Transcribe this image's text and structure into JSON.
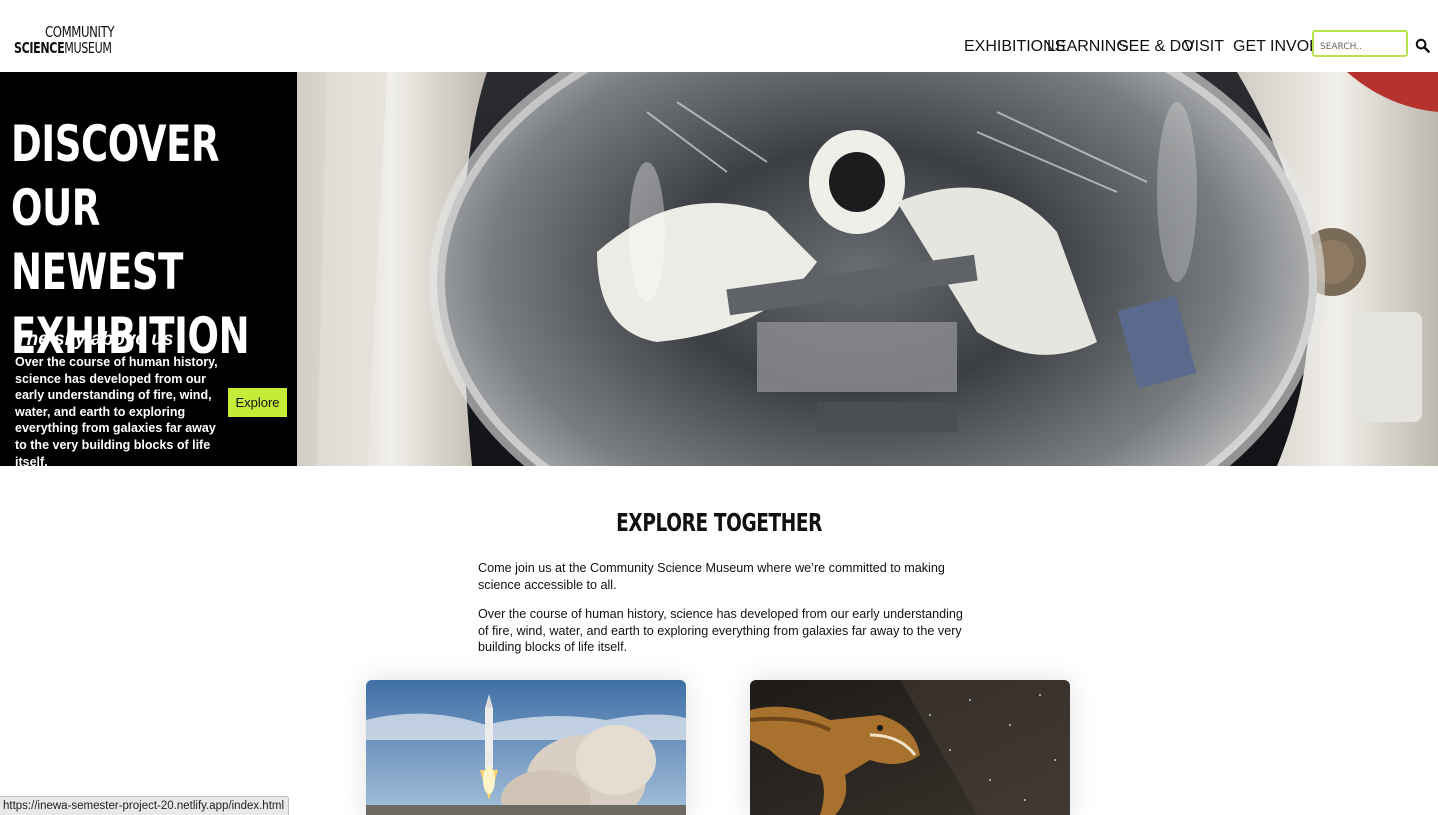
{
  "header": {
    "logo": {
      "line1": "COMMUNITY",
      "line2_bold": "SCIENCE",
      "line2_rest": "MUSEUM"
    },
    "nav": [
      "EXHIBITIONS",
      "LEARNING",
      "SEE & DO",
      "VISIT",
      "GET INVOLVED"
    ],
    "search": {
      "placeholder": "SEARCH.."
    },
    "accent_color": "#c6ec3a"
  },
  "hero": {
    "title": "DISCOVER OUR\nNEWEST\nEXHIBITION",
    "subtitle": "The sky above us",
    "description": "Over the course of human history, science has developed from our early understanding of fire, wind, water, and earth to exploring everything from galaxies far away to the very building blocks of life itself.",
    "button": "Explore"
  },
  "explore": {
    "title": "EXPLORE TOGETHER",
    "paragraph1": "Come join us at the Community Science Museum where we’re committed to making science accessible to all.",
    "paragraph2": "Over the course of human history, science has developed from our early understanding of fire, wind, water, and earth to exploring everything from galaxies far away to the very building blocks of life itself."
  },
  "status_bar": {
    "url": "https://inewa-semester-project-20.netlify.app/index.html"
  }
}
